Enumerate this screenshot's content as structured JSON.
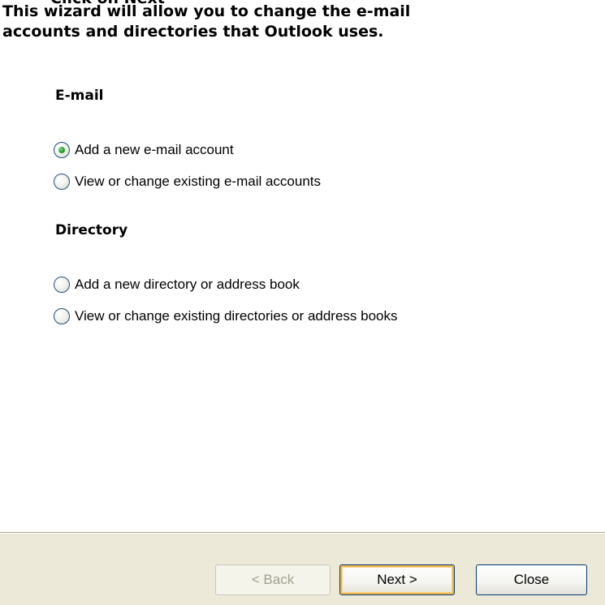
{
  "wizard": {
    "cropped_heading": "Click on Next",
    "intro_line1": "This wizard will allow you to change the e-mail",
    "intro_line2": "accounts and directories that Outlook uses."
  },
  "email_section": {
    "title": "E-mail",
    "options": [
      {
        "label": "Add a new e-mail account",
        "selected": true
      },
      {
        "label": "View or change existing e-mail accounts",
        "selected": false
      }
    ]
  },
  "directory_section": {
    "title": "Directory",
    "options": [
      {
        "label": "Add a new directory or address book",
        "selected": false
      },
      {
        "label": "View or change existing directories or address books",
        "selected": false
      }
    ]
  },
  "buttons": {
    "back_label": "< Back",
    "back_enabled": false,
    "next_label": "Next >",
    "close_label": "Close"
  },
  "colors": {
    "footer_background": "#ece9d8",
    "radio_selected_dot": "#21a121",
    "next_button_focus": "#f0b64b",
    "disabled_text": "#a1a192"
  }
}
